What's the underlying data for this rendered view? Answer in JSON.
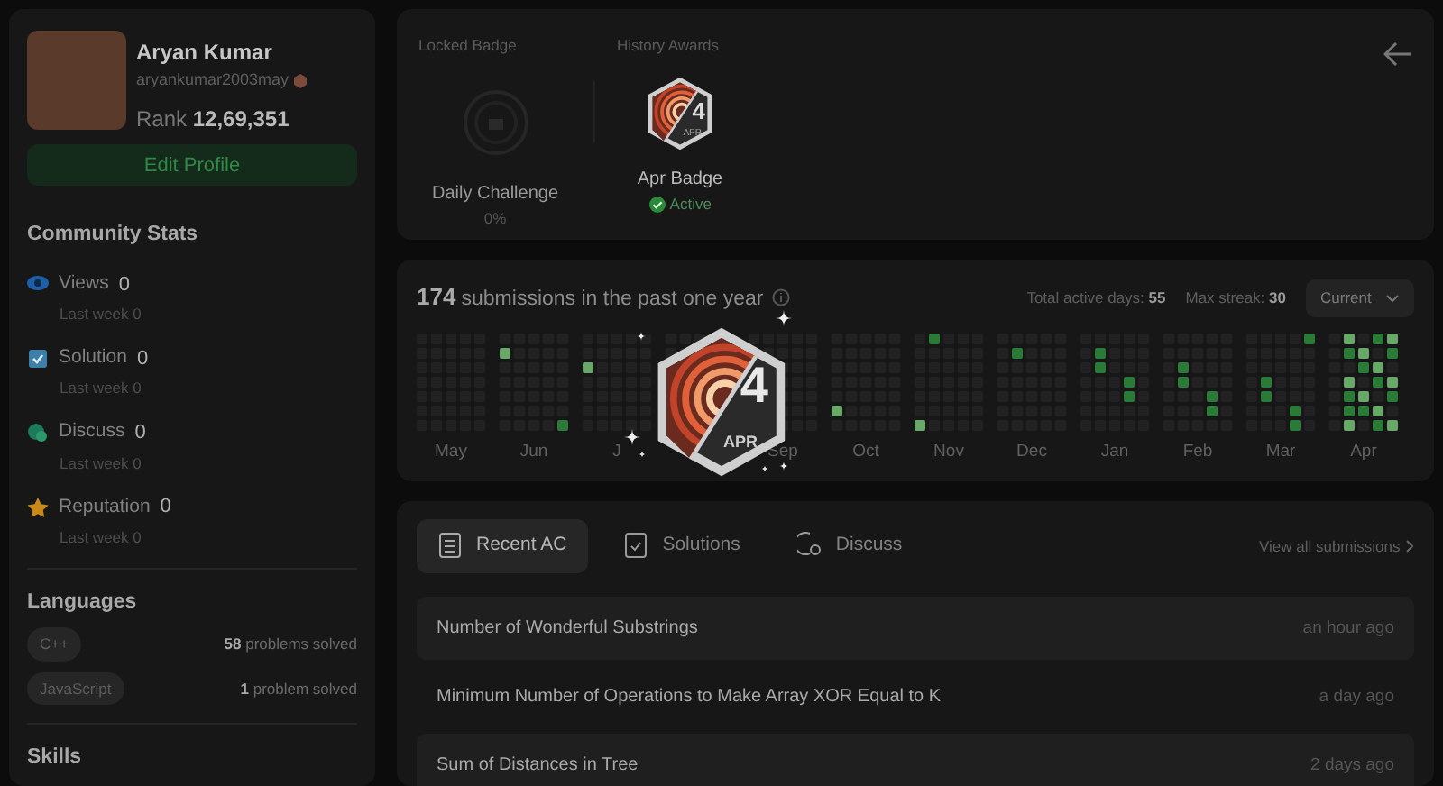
{
  "profile": {
    "name": "Aryan Kumar",
    "username": "aryankumar2003may",
    "rank_label": "Rank",
    "rank": "12,69,351",
    "edit_button": "Edit Profile"
  },
  "community_stats": {
    "title": "Community Stats",
    "items": [
      {
        "kind": "views",
        "label": "Views",
        "value": "0",
        "sub_label": "Last week",
        "sub_value": "0"
      },
      {
        "kind": "solution",
        "label": "Solution",
        "value": "0",
        "sub_label": "Last week",
        "sub_value": "0"
      },
      {
        "kind": "discuss",
        "label": "Discuss",
        "value": "0",
        "sub_label": "Last week",
        "sub_value": "0"
      },
      {
        "kind": "reputation",
        "label": "Reputation",
        "value": "0",
        "sub_label": "Last week",
        "sub_value": "0"
      }
    ]
  },
  "languages": {
    "title": "Languages",
    "items": [
      {
        "tag": "C++",
        "count": "58",
        "suffix": "problems solved"
      },
      {
        "tag": "JavaScript",
        "count": "1",
        "suffix": "problem solved"
      }
    ]
  },
  "skills": {
    "title": "Skills"
  },
  "badges": {
    "locked": {
      "heading": "Locked Badge",
      "name": "Daily Challenge",
      "progress": "0%"
    },
    "history": {
      "heading": "History Awards",
      "name": "Apr Badge",
      "status": "Active",
      "badge_number": "4",
      "badge_month": "APR"
    }
  },
  "calendar": {
    "count": "174",
    "text": "submissions in the past one year",
    "total_label": "Total active days:",
    "total": "55",
    "streak_label": "Max streak:",
    "streak": "30",
    "select": "Current",
    "months": [
      "May",
      "Jun",
      "J",
      "Sep",
      "Oct",
      "Nov",
      "Dec",
      "Jan",
      "Feb",
      "Mar",
      "Apr"
    ]
  },
  "overlay_badge": {
    "number": "4",
    "month": "APR"
  },
  "activity": {
    "tabs": [
      {
        "label": "Recent AC",
        "kind": "recent",
        "selected": true
      },
      {
        "label": "Solutions",
        "kind": "solutions",
        "selected": false
      },
      {
        "label": "Discuss",
        "kind": "discuss",
        "selected": false
      }
    ],
    "view_all": "View all submissions",
    "submissions": [
      {
        "title": "Number of Wonderful Substrings",
        "time": "an hour ago"
      },
      {
        "title": "Minimum Number of Operations to Make Array XOR Equal to K",
        "time": "a day ago"
      },
      {
        "title": "Sum of Distances in Tree",
        "time": "2 days ago"
      }
    ]
  }
}
